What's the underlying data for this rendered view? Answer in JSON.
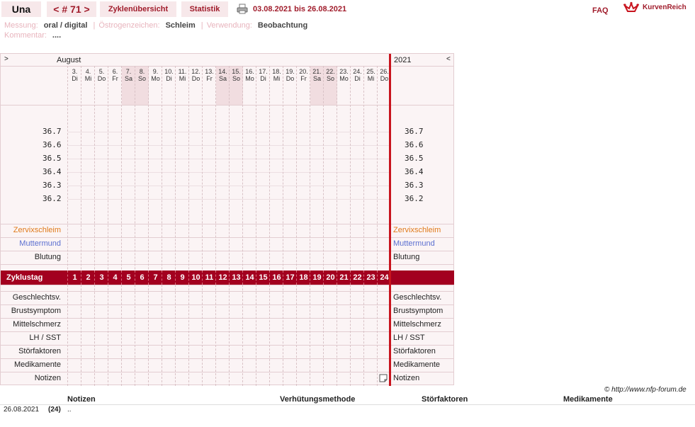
{
  "header": {
    "name": "Una",
    "cycle": "< # 71 >",
    "tab_overview": "Zyklenübersicht",
    "tab_statistics": "Statistik",
    "range": "03.08.2021 bis 26.08.2021",
    "faq": "FAQ",
    "brand": "KurvenReich"
  },
  "meta": {
    "messung_label": "Messung:",
    "messung_value": "oral / digital",
    "oestrogen_label": "Östrogenzeichen:",
    "oestrogen_value": "Schleim",
    "verwendung_label": "Verwendung:",
    "verwendung_value": "Beobachtung",
    "kommentar_label": "Kommentar:",
    "kommentar_value": "...."
  },
  "chart": {
    "nav_prev": ">",
    "month": "August",
    "year": "2021",
    "nav_next": "<",
    "days": [
      {
        "d": "3.",
        "w": "Di"
      },
      {
        "d": "4.",
        "w": "Mi"
      },
      {
        "d": "5.",
        "w": "Do"
      },
      {
        "d": "6.",
        "w": "Fr"
      },
      {
        "d": "7.",
        "w": "Sa"
      },
      {
        "d": "8.",
        "w": "So"
      },
      {
        "d": "9.",
        "w": "Mo"
      },
      {
        "d": "10.",
        "w": "Di"
      },
      {
        "d": "11.",
        "w": "Mi"
      },
      {
        "d": "12.",
        "w": "Do"
      },
      {
        "d": "13.",
        "w": "Fr"
      },
      {
        "d": "14.",
        "w": "Sa"
      },
      {
        "d": "15.",
        "w": "So"
      },
      {
        "d": "16.",
        "w": "Mo"
      },
      {
        "d": "17.",
        "w": "Di"
      },
      {
        "d": "18.",
        "w": "Mi"
      },
      {
        "d": "19.",
        "w": "Do"
      },
      {
        "d": "20.",
        "w": "Fr"
      },
      {
        "d": "21.",
        "w": "Sa"
      },
      {
        "d": "22.",
        "w": "So"
      },
      {
        "d": "23.",
        "w": "Mo"
      },
      {
        "d": "24.",
        "w": "Di"
      },
      {
        "d": "25.",
        "w": "Mi"
      },
      {
        "d": "26.",
        "w": "Do"
      }
    ],
    "temperatures": [
      "36.7",
      "36.6",
      "36.5",
      "36.4",
      "36.3",
      "36.2"
    ],
    "rows_top": [
      {
        "label": "Zervixschleim",
        "color": "#e07a1a"
      },
      {
        "label": "Muttermund",
        "color": "#5b6fd0"
      },
      {
        "label": "Blutung",
        "color": "#222222"
      }
    ],
    "cycle_day_label": "Zyklustag",
    "cycle_days": [
      "1",
      "2",
      "3",
      "4",
      "5",
      "6",
      "7",
      "8",
      "9",
      "10",
      "11",
      "12",
      "13",
      "14",
      "15",
      "16",
      "17",
      "18",
      "19",
      "20",
      "21",
      "22",
      "23",
      "24"
    ],
    "rows_bottom": [
      "Geschlechtsv.",
      "Brustsymptom",
      "Mittelschmerz",
      "LH / SST",
      "Störfaktoren",
      "Medikamente",
      "Notizen"
    ]
  },
  "footer": {
    "copyright": "© http://www.nfp-forum.de",
    "col_notes": "Notizen",
    "col_method": "Verhütungsmethode",
    "col_disturb": "Störfaktoren",
    "col_meds": "Medikamente",
    "row_date": "26.08.2021",
    "row_day": "(24)",
    "row_note": ".."
  }
}
